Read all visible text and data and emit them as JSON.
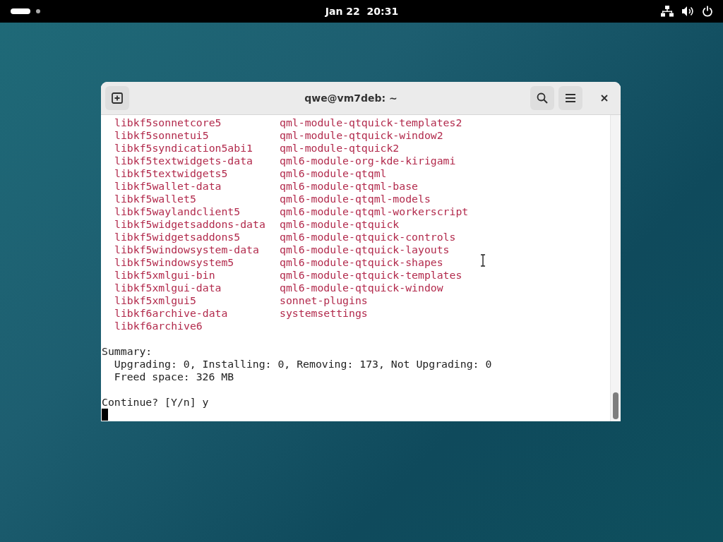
{
  "top_bar": {
    "clock": "Jan 22  20:31"
  },
  "terminal": {
    "title": "qwe@vm7deb: ~",
    "packages": [
      {
        "left": "libkf5sonnetcore5",
        "right": "qml-module-qtquick-templates2"
      },
      {
        "left": "libkf5sonnetui5",
        "right": "qml-module-qtquick-window2"
      },
      {
        "left": "libkf5syndication5abi1",
        "right": "qml-module-qtquick2"
      },
      {
        "left": "libkf5textwidgets-data",
        "right": "qml6-module-org-kde-kirigami"
      },
      {
        "left": "libkf5textwidgets5",
        "right": "qml6-module-qtqml"
      },
      {
        "left": "libkf5wallet-data",
        "right": "qml6-module-qtqml-base"
      },
      {
        "left": "libkf5wallet5",
        "right": "qml6-module-qtqml-models"
      },
      {
        "left": "libkf5waylandclient5",
        "right": "qml6-module-qtqml-workerscript"
      },
      {
        "left": "libkf5widgetsaddons-data",
        "right": "qml6-module-qtquick"
      },
      {
        "left": "libkf5widgetsaddons5",
        "right": "qml6-module-qtquick-controls"
      },
      {
        "left": "libkf5windowsystem-data",
        "right": "qml6-module-qtquick-layouts"
      },
      {
        "left": "libkf5windowsystem5",
        "right": "qml6-module-qtquick-shapes"
      },
      {
        "left": "libkf5xmlgui-bin",
        "right": "qml6-module-qtquick-templates"
      },
      {
        "left": "libkf5xmlgui-data",
        "right": "qml6-module-qtquick-window"
      },
      {
        "left": "libkf5xmlgui5",
        "right": "sonnet-plugins"
      },
      {
        "left": "libkf6archive-data",
        "right": "systemsettings"
      },
      {
        "left": "libkf6archive6"
      }
    ],
    "summary": [
      "Summary:",
      "  Upgrading: 0, Installing: 0, Removing: 173, Not Upgrading: 0",
      "  Freed space: 326 MB"
    ],
    "prompt": "Continue? [Y/n] y"
  }
}
